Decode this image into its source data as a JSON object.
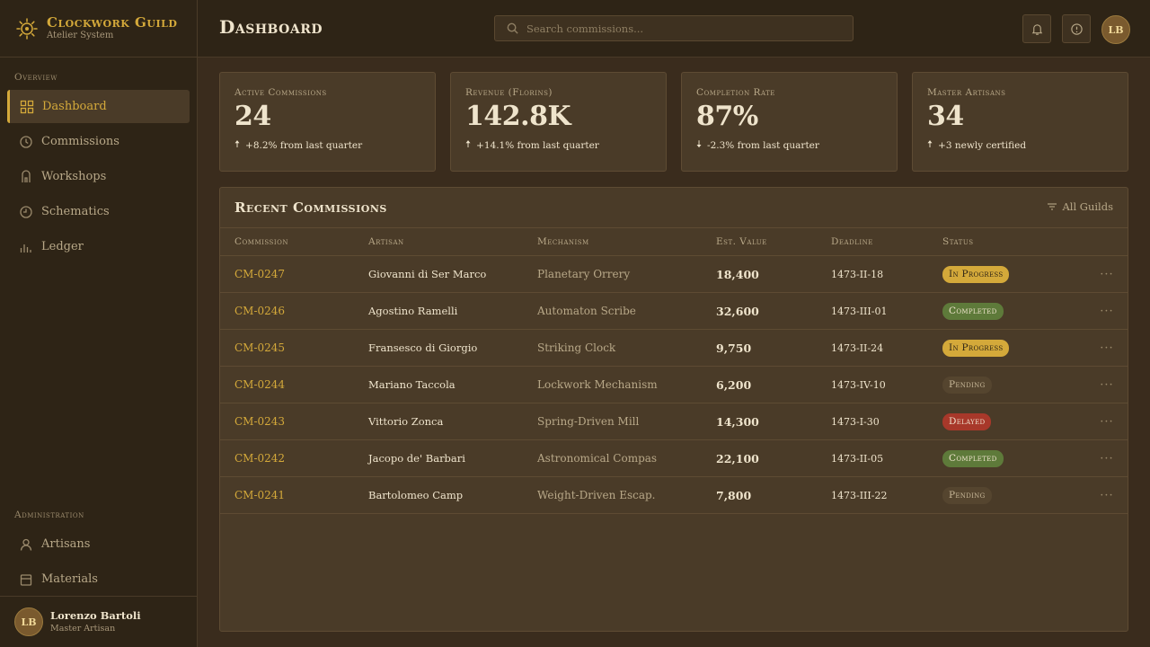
{
  "brand": {
    "title": "Clockwork Guild",
    "subtitle": "Atelier System"
  },
  "sidebar": {
    "section_overview": "Overview",
    "section_admin": "Administration",
    "items": [
      {
        "label": "Dashboard",
        "icon": "grid-icon",
        "active": true
      },
      {
        "label": "Commissions",
        "icon": "clock-icon"
      },
      {
        "label": "Workshops",
        "icon": "building-icon"
      },
      {
        "label": "Schematics",
        "icon": "clock-icon"
      },
      {
        "label": "Ledger",
        "icon": "bar-chart-icon"
      }
    ],
    "admin_items": [
      {
        "label": "Artisans",
        "icon": "user-icon"
      },
      {
        "label": "Materials",
        "icon": "box-icon"
      }
    ],
    "user": {
      "initials": "LB",
      "name": "Lorenzo Bartoli",
      "role": "Master Artisan"
    }
  },
  "header": {
    "title": "Dashboard",
    "search_placeholder": "Search commissions...",
    "avatar_initials": "LB"
  },
  "stats": [
    {
      "label": "Active Commissions",
      "value": "24",
      "delta": "+8.2% from last quarter",
      "direction": "up"
    },
    {
      "label": "Revenue (Florins)",
      "value": "142.8K",
      "delta": "+14.1% from last quarter",
      "direction": "up"
    },
    {
      "label": "Completion Rate",
      "value": "87%",
      "delta": "-2.3% from last quarter",
      "direction": "down"
    },
    {
      "label": "Master Artisans",
      "value": "34",
      "delta": "+3 newly certified",
      "direction": "up"
    }
  ],
  "table": {
    "title": "Recent Commissions",
    "filter_label": "All Guilds",
    "columns": [
      "Commission",
      "Artisan",
      "Mechanism",
      "Est. Value",
      "Deadline",
      "Status"
    ],
    "rows": [
      {
        "id": "CM-0247",
        "artisan": "Giovanni di Ser Marco",
        "mechanism": "Planetary Orrery",
        "value": "18,400",
        "deadline": "1473-II-18",
        "status": "In Progress",
        "status_type": "progress"
      },
      {
        "id": "CM-0246",
        "artisan": "Agostino Ramelli",
        "mechanism": "Automaton Scribe",
        "value": "32,600",
        "deadline": "1473-III-01",
        "status": "Completed",
        "status_type": "completed"
      },
      {
        "id": "CM-0245",
        "artisan": "Fransesco di Giorgio",
        "mechanism": "Striking Clock",
        "value": "9,750",
        "deadline": "1473-II-24",
        "status": "In Progress",
        "status_type": "progress"
      },
      {
        "id": "CM-0244",
        "artisan": "Mariano Taccola",
        "mechanism": "Lockwork Mechanism",
        "value": "6,200",
        "deadline": "1473-IV-10",
        "status": "Pending",
        "status_type": "pending"
      },
      {
        "id": "CM-0243",
        "artisan": "Vittorio Zonca",
        "mechanism": "Spring-Driven Mill",
        "value": "14,300",
        "deadline": "1473-I-30",
        "status": "Delayed",
        "status_type": "delayed"
      },
      {
        "id": "CM-0242",
        "artisan": "Jacopo de' Barbari",
        "mechanism": "Astronomical Compas",
        "value": "22,100",
        "deadline": "1473-II-05",
        "status": "Completed",
        "status_type": "completed"
      },
      {
        "id": "CM-0241",
        "artisan": "Bartolomeo Camp",
        "mechanism": "Weight-Driven Escap.",
        "value": "7,800",
        "deadline": "1473-III-22",
        "status": "Pending",
        "status_type": "pending"
      }
    ],
    "more_glyph": "···"
  },
  "colors": {
    "accent": "#d4a93a",
    "background": "#3a2c1d",
    "sidebar": "#2e2416",
    "card": "#4a3b28"
  }
}
